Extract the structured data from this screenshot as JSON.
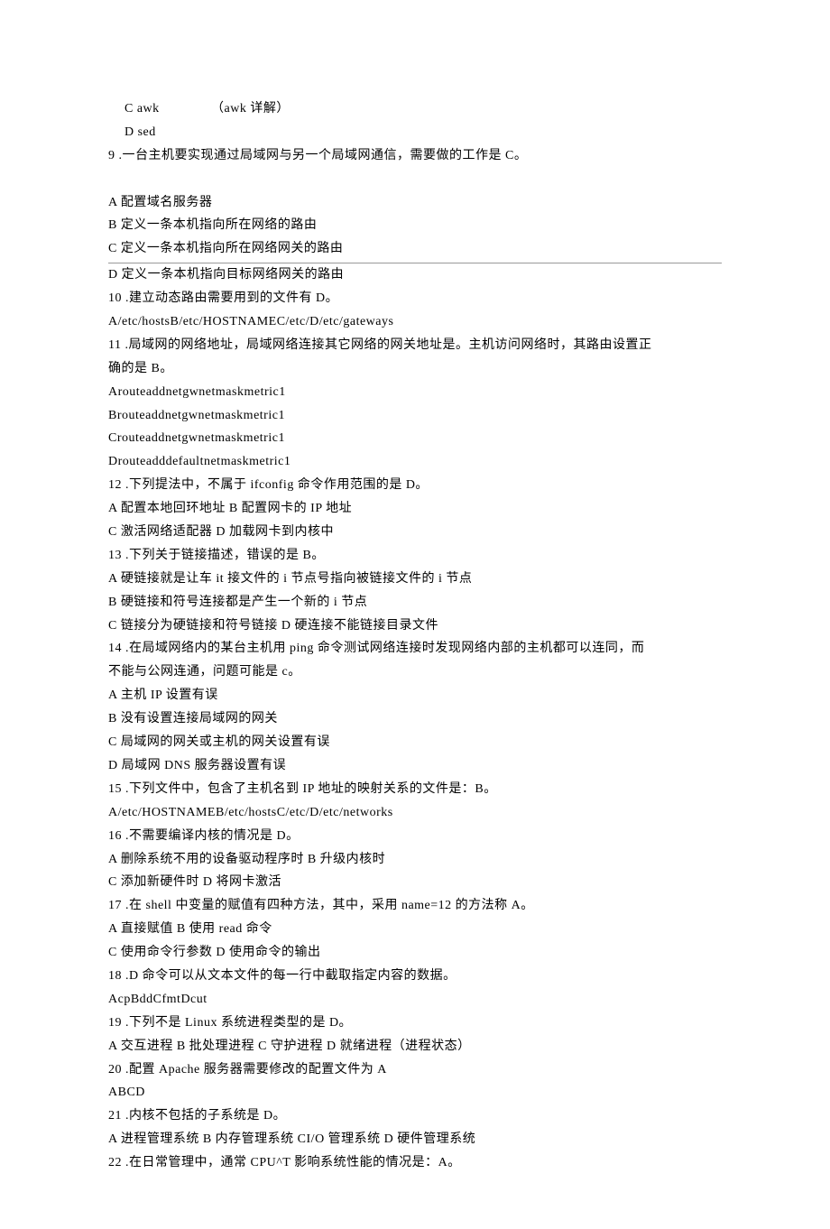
{
  "lines": [
    {
      "cls": "indent1 awk-row",
      "html": "<span class='awk-col1'>C awk</span><span>（awk 详解）</span>"
    },
    {
      "cls": "indent1",
      "text": "D sed"
    },
    {
      "cls": "",
      "text": "9 .一台主机要实现通过局域网与另一个局域网通信，需要做的工作是 C。"
    },
    {
      "cls": "",
      "text": " "
    },
    {
      "cls": "",
      "text": "A 配置域名服务器"
    },
    {
      "cls": "",
      "text": "B 定义一条本机指向所在网络的路由"
    },
    {
      "cls": "underline",
      "text": "C 定义一条本机指向所在网络网关的路由"
    },
    {
      "cls": "",
      "text": "D 定义一条本机指向目标网络网关的路由"
    },
    {
      "cls": "",
      "text": "10 .建立动态路由需要用到的文件有 D。"
    },
    {
      "cls": "",
      "text": "A/etc/hostsB/etc/HOSTNAMEC/etc/D/etc/gateways"
    },
    {
      "cls": "",
      "text": "11 .局域网的网络地址，局域网络连接其它网络的网关地址是。主机访问网络时，其路由设置正"
    },
    {
      "cls": "",
      "text": "确的是 B。"
    },
    {
      "cls": "",
      "text": "Arouteaddnetgwnetmaskmetric1"
    },
    {
      "cls": "",
      "text": "Brouteaddnetgwnetmaskmetric1"
    },
    {
      "cls": "",
      "text": "Crouteaddnetgwnetmaskmetric1"
    },
    {
      "cls": "",
      "text": "Drouteadddefaultnetmaskmetric1"
    },
    {
      "cls": "",
      "text": "12 .下列提法中，不属于 ifconfig 命令作用范围的是 D。"
    },
    {
      "cls": "",
      "text": "A 配置本地回环地址 B 配置网卡的 IP 地址"
    },
    {
      "cls": "",
      "text": "C 激活网络适配器 D 加载网卡到内核中"
    },
    {
      "cls": "",
      "text": "13 .下列关于链接描述，错误的是 B。"
    },
    {
      "cls": "",
      "text": "A 硬链接就是让车 it 接文件的 i 节点号指向被链接文件的 i 节点"
    },
    {
      "cls": "",
      "text": "B 硬链接和符号连接都是产生一个新的 i 节点"
    },
    {
      "cls": "",
      "text": "C 链接分为硬链接和符号链接 D 硬连接不能链接目录文件"
    },
    {
      "cls": "",
      "text": "14 .在局域网络内的某台主机用 ping 命令测试网络连接时发现网络内部的主机都可以连同，而"
    },
    {
      "cls": "",
      "text": "不能与公网连通，问题可能是 c。"
    },
    {
      "cls": "",
      "text": "A 主机 IP 设置有误"
    },
    {
      "cls": "",
      "text": "B 没有设置连接局域网的网关"
    },
    {
      "cls": "",
      "text": "C 局域网的网关或主机的网关设置有误"
    },
    {
      "cls": "",
      "text": "D 局域网 DNS 服务器设置有误"
    },
    {
      "cls": "",
      "text": "15 .下列文件中，包含了主机名到 IP 地址的映射关系的文件是：B。"
    },
    {
      "cls": "",
      "text": "A/etc/HOSTNAMEB/etc/hostsC/etc/D/etc/networks"
    },
    {
      "cls": "",
      "text": "16 .不需要编译内核的情况是 D。"
    },
    {
      "cls": "",
      "text": "A 删除系统不用的设备驱动程序时 B 升级内核时"
    },
    {
      "cls": "",
      "text": "C 添加新硬件时 D 将网卡激活"
    },
    {
      "cls": "",
      "text": "17 .在 shell 中变量的赋值有四种方法，其中，采用 name=12 的方法称 A。"
    },
    {
      "cls": "",
      "text": "A 直接赋值 B 使用 read 命令"
    },
    {
      "cls": "",
      "text": "C 使用命令行参数 D 使用命令的输出"
    },
    {
      "cls": "",
      "text": "18 .D 命令可以从文本文件的每一行中截取指定内容的数据。"
    },
    {
      "cls": "",
      "text": "AcpBddCfmtDcut"
    },
    {
      "cls": "",
      "text": "19 .下列不是 Linux 系统进程类型的是 D。"
    },
    {
      "cls": "",
      "text": "A 交互进程 B 批处理进程 C 守护进程 D 就绪进程（进程状态）"
    },
    {
      "cls": "",
      "text": "20 .配置 Apache 服务器需要修改的配置文件为 A"
    },
    {
      "cls": "",
      "text": "ABCD"
    },
    {
      "cls": "",
      "text": "21 .内核不包括的子系统是 D。"
    },
    {
      "cls": "",
      "text": "A 进程管理系统 B 内存管理系统 CI/O 管理系统 D 硬件管理系统"
    },
    {
      "cls": "",
      "text": "22 .在日常管理中，通常 CPU^T 影响系统性能的情况是：A。"
    }
  ]
}
